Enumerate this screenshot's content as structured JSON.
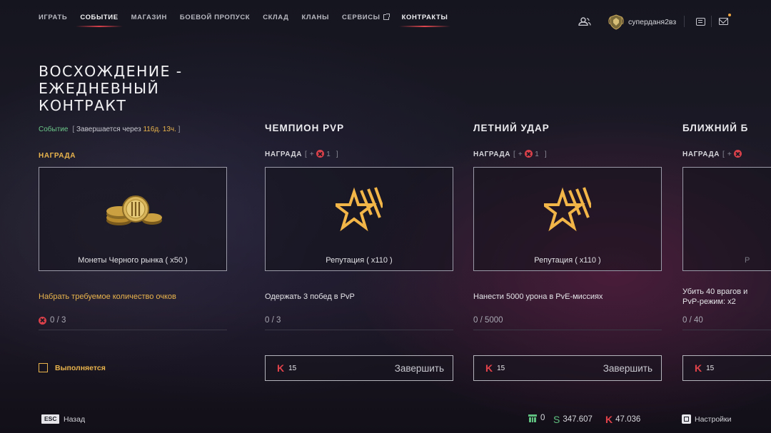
{
  "nav": {
    "items": [
      {
        "label": "ИГРАТЬ"
      },
      {
        "label": "СОБЫТИЕ"
      },
      {
        "label": "МАГАЗИН"
      },
      {
        "label": "БОЕВОЙ ПРОПУСК"
      },
      {
        "label": "СКЛАД"
      },
      {
        "label": "КЛАНЫ"
      },
      {
        "label": "СЕРВИСЫ"
      },
      {
        "label": "КОНТРАКТЫ"
      }
    ],
    "active_index": 7,
    "selected_index": 1
  },
  "user": {
    "name": "суперданя2вз"
  },
  "contract": {
    "title": "ВОСХОЖДЕНИЕ - ЕЖЕДНЕВНЫЙ КОНТРАКТ",
    "event_label": "Событие",
    "ends_prefix": "Завершается через",
    "ends_value": "116д. 13ч.",
    "reward_label": "НАГРАДА",
    "reward_caption": "Монеты Черного рынка ( x50 )",
    "task": "Набрать требуемое количество очков",
    "progress": "0 / 3",
    "status": "Выполняется"
  },
  "cards": [
    {
      "title": "ЧЕМПИОН PVP",
      "reward_label": "НАГРАДА",
      "reward_plus": "+",
      "reward_count": "1",
      "reward_caption": "Репутация ( x110 )",
      "task": "Одержать 3 побед в PvP",
      "progress": "0 / 3",
      "cost": "15",
      "button": "Завершить"
    },
    {
      "title": "ЛЕТНИЙ УДАР",
      "reward_label": "НАГРАДА",
      "reward_plus": "+",
      "reward_count": "1",
      "reward_caption": "Репутация ( x110 )",
      "task": "Нанести 5000 урона в PvE-миссиях",
      "progress": "0 / 5000",
      "cost": "15",
      "button": "Завершить"
    },
    {
      "title": "БЛИЖНИЙ Б",
      "reward_label": "НАГРАДА",
      "reward_plus": "+",
      "reward_caption": "Р",
      "task_line1": "Убить 40 врагов и",
      "task_line2": "PvP-режим: x2",
      "progress": "0 / 40",
      "cost": "15"
    }
  ],
  "bottom": {
    "esc_key": "ESC",
    "back": "Назад",
    "currency_a": "0",
    "currency_s": "347.607",
    "currency_k": "47.036",
    "settings": "Настройки"
  },
  "colors": {
    "accent_gold": "#e9b44c",
    "accent_red": "#e2424a",
    "event_green": "#6cc98a",
    "coin_green": "#5fbf7f"
  }
}
